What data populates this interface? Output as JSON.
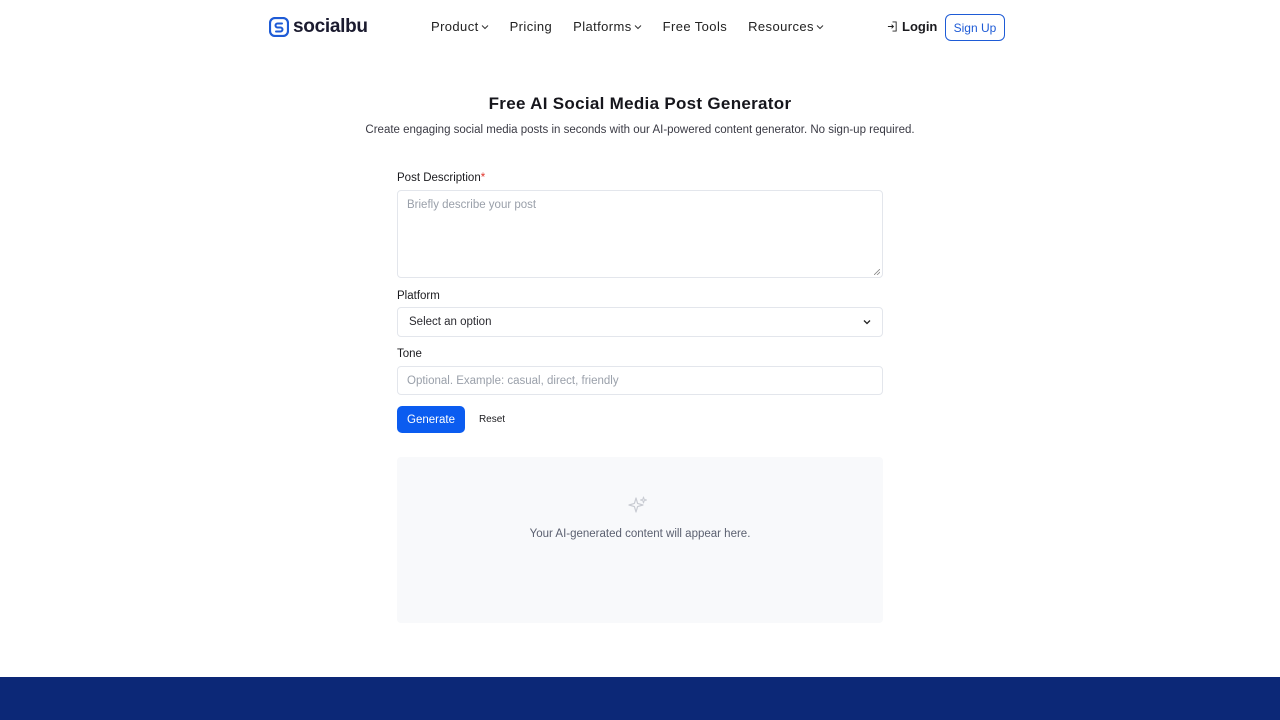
{
  "brand": {
    "name": "socialbu",
    "color": "#1e5bd6"
  },
  "nav": {
    "items": [
      {
        "label": "Product",
        "has_dropdown": true
      },
      {
        "label": "Pricing",
        "has_dropdown": false
      },
      {
        "label": "Platforms",
        "has_dropdown": true
      },
      {
        "label": "Free Tools",
        "has_dropdown": false
      },
      {
        "label": "Resources",
        "has_dropdown": true
      }
    ],
    "login_label": "Login",
    "signup_label": "Sign Up"
  },
  "page": {
    "title": "Free AI Social Media Post Generator",
    "subtitle": "Create engaging social media posts in seconds with our AI-powered content generator. No sign-up required."
  },
  "form": {
    "description": {
      "label": "Post Description",
      "required_mark": "*",
      "placeholder": "Briefly describe your post",
      "value": ""
    },
    "platform": {
      "label": "Platform",
      "selected": "Select an option"
    },
    "tone": {
      "label": "Tone",
      "placeholder": "Optional. Example: casual, direct, friendly",
      "value": ""
    },
    "generate_label": "Generate",
    "reset_label": "Reset"
  },
  "output": {
    "placeholder_text": "Your AI-generated content will appear here.",
    "icon": "sparkle-icon"
  },
  "colors": {
    "primary": "#0b5cf0",
    "footer": "#0c2877",
    "required": "#e0352b"
  }
}
